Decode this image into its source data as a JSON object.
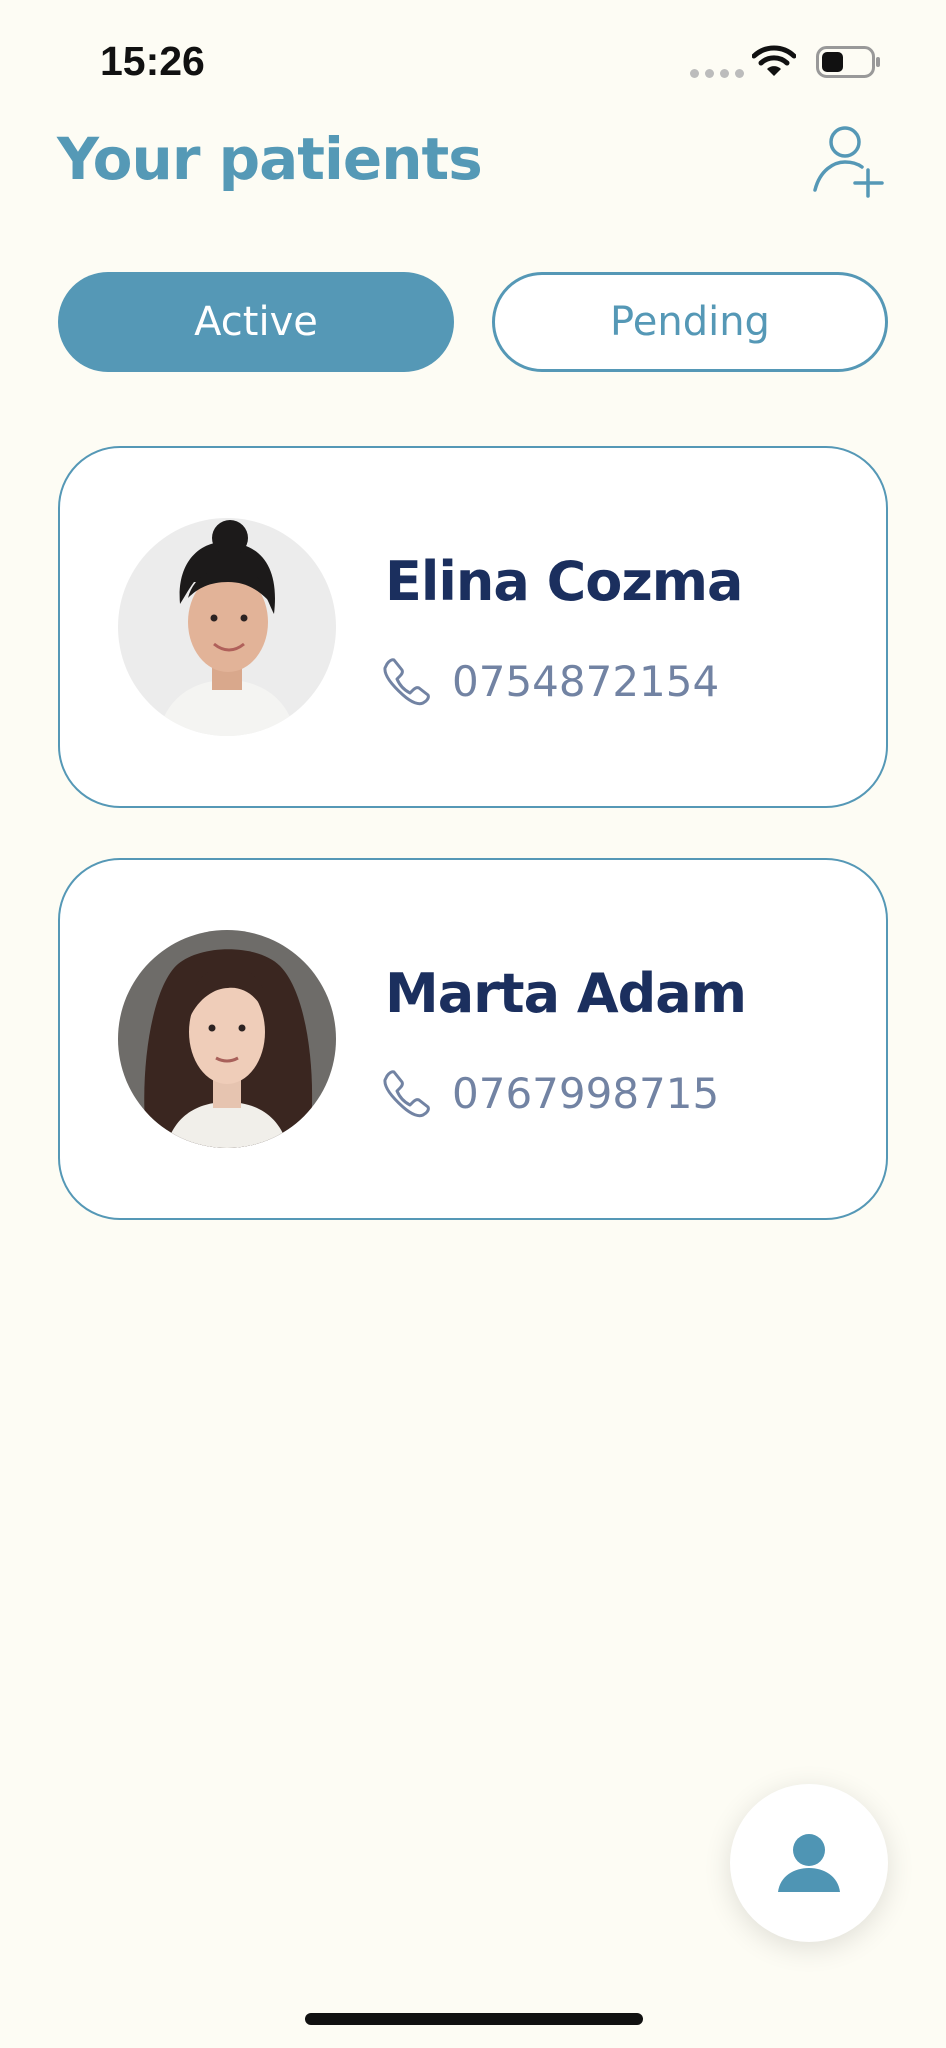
{
  "status_bar": {
    "time": "15:26"
  },
  "header": {
    "title": "Your patients",
    "add_icon": "add-person-icon"
  },
  "tabs": [
    {
      "label": "Active",
      "selected": true
    },
    {
      "label": "Pending",
      "selected": false
    }
  ],
  "patients": [
    {
      "name": "Elina Cozma",
      "phone": "0754872154"
    },
    {
      "name": "Marta Adam",
      "phone": "0767998715"
    }
  ],
  "fab": {
    "icon": "profile-icon"
  },
  "colors": {
    "background": "#fdfcf4",
    "accent": "#5598b6",
    "name_text": "#1b2f5e",
    "phone_text": "#7283a3"
  }
}
